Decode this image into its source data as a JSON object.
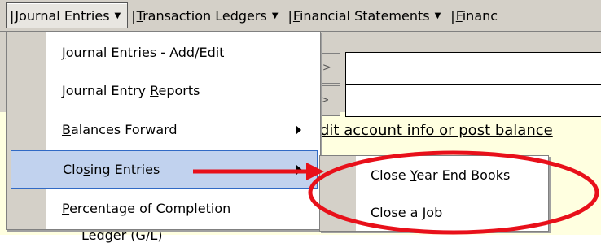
{
  "menubar": {
    "items": [
      {
        "pre": "",
        "accel": "J",
        "post": "ournal Entries"
      },
      {
        "pre": "",
        "accel": "T",
        "post": "ransaction Ledgers"
      },
      {
        "pre": "",
        "accel": "F",
        "post": "inancial Statements"
      },
      {
        "pre": "",
        "accel": "F",
        "post": "inanc"
      }
    ]
  },
  "dropdown": {
    "items": [
      {
        "pre": "",
        "accel": "J",
        "post": "ournal Entries - Add/Edit",
        "submenu": false
      },
      {
        "pre": "Journal Entry ",
        "accel": "R",
        "post": "eports",
        "submenu": false
      },
      {
        "pre": "",
        "accel": "B",
        "post": "alances Forward",
        "submenu": true
      },
      {
        "pre": "Clo",
        "accel": "s",
        "post": "ing Entries",
        "submenu": true,
        "highlighted": true
      },
      {
        "pre": "",
        "accel": "P",
        "post": "ercentage of Completion",
        "submenu": false
      }
    ]
  },
  "submenu": {
    "items": [
      {
        "pre": "Close ",
        "accel": "Y",
        "post": "ear End Books"
      },
      {
        "pre": "Close a ",
        "accel": "J",
        "post": "ob"
      }
    ]
  },
  "background": {
    "nav_button_1": "->",
    "nav_button_2": ">",
    "hint_text": "dit account info or post balance",
    "bottom_text": "Ledger (G/L)"
  },
  "annotation": {
    "color": "#e8101a"
  }
}
